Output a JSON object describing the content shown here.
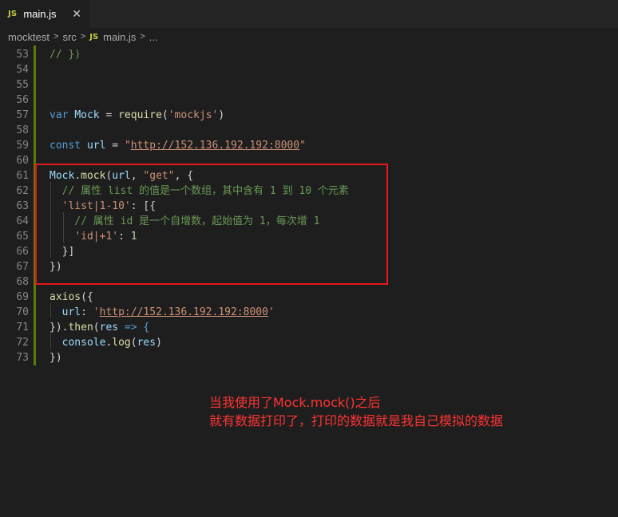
{
  "tab": {
    "icon": "JS",
    "label": "main.js",
    "close": "✕"
  },
  "breadcrumb": [
    "mocktest",
    "src",
    "main.js",
    "..."
  ],
  "breadcrumb_icon": "JS",
  "lines": [
    {
      "n": "53",
      "tokens": [
        {
          "t": "// })",
          "c": "cmt"
        }
      ]
    },
    {
      "n": "54",
      "tokens": []
    },
    {
      "n": "55",
      "tokens": []
    },
    {
      "n": "56",
      "tokens": []
    },
    {
      "n": "57",
      "tokens": [
        {
          "t": "var ",
          "c": "kw"
        },
        {
          "t": "Mock",
          "c": "var"
        },
        {
          "t": " = ",
          "c": ""
        },
        {
          "t": "require",
          "c": "fn"
        },
        {
          "t": "(",
          "c": ""
        },
        {
          "t": "'mockjs'",
          "c": "str"
        },
        {
          "t": ")",
          "c": ""
        }
      ]
    },
    {
      "n": "58",
      "tokens": []
    },
    {
      "n": "59",
      "tokens": [
        {
          "t": "const ",
          "c": "kw"
        },
        {
          "t": "url",
          "c": "var"
        },
        {
          "t": " = ",
          "c": ""
        },
        {
          "t": "\"",
          "c": "str"
        },
        {
          "t": "http://152.136.192.192:8000",
          "c": "str url"
        },
        {
          "t": "\"",
          "c": "str"
        }
      ]
    },
    {
      "n": "60",
      "tokens": []
    },
    {
      "n": "61",
      "tokens": [
        {
          "t": "Mock",
          "c": "var"
        },
        {
          "t": ".",
          "c": ""
        },
        {
          "t": "mock",
          "c": "fn"
        },
        {
          "t": "(",
          "c": ""
        },
        {
          "t": "url",
          "c": "var"
        },
        {
          "t": ", ",
          "c": ""
        },
        {
          "t": "\"get\"",
          "c": "str"
        },
        {
          "t": ", {",
          "c": ""
        }
      ]
    },
    {
      "n": "62",
      "tokens": [
        {
          "t": "  // 属性 list 的值是一个数组，其中含有 1 到 10 个元素",
          "c": "cmt"
        }
      ]
    },
    {
      "n": "63",
      "tokens": [
        {
          "t": "  ",
          "c": ""
        },
        {
          "t": "'list|1-10'",
          "c": "str"
        },
        {
          "t": ": [{",
          "c": ""
        }
      ]
    },
    {
      "n": "64",
      "tokens": [
        {
          "t": "    // 属性 id 是一个自增数，起始值为 1，每次增 1",
          "c": "cmt"
        }
      ]
    },
    {
      "n": "65",
      "tokens": [
        {
          "t": "    ",
          "c": ""
        },
        {
          "t": "'id|+1'",
          "c": "str"
        },
        {
          "t": ": ",
          "c": ""
        },
        {
          "t": "1",
          "c": "num"
        }
      ]
    },
    {
      "n": "66",
      "tokens": [
        {
          "t": "  }]",
          "c": ""
        }
      ]
    },
    {
      "n": "67",
      "tokens": [
        {
          "t": "})",
          "c": ""
        }
      ]
    },
    {
      "n": "68",
      "tokens": []
    },
    {
      "n": "69",
      "tokens": [
        {
          "t": "axios",
          "c": "fn"
        },
        {
          "t": "({",
          "c": ""
        }
      ]
    },
    {
      "n": "70",
      "tokens": [
        {
          "t": "  ",
          "c": ""
        },
        {
          "t": "url",
          "c": "var"
        },
        {
          "t": ": ",
          "c": ""
        },
        {
          "t": "'",
          "c": "str"
        },
        {
          "t": "http://152.136.192.192:8000",
          "c": "str url"
        },
        {
          "t": "'",
          "c": "str"
        }
      ]
    },
    {
      "n": "71",
      "tokens": [
        {
          "t": "}).",
          "c": ""
        },
        {
          "t": "then",
          "c": "fn"
        },
        {
          "t": "(",
          "c": ""
        },
        {
          "t": "res",
          "c": "var"
        },
        {
          "t": " => {",
          "c": "kw"
        }
      ]
    },
    {
      "n": "72",
      "tokens": [
        {
          "t": "  ",
          "c": ""
        },
        {
          "t": "console",
          "c": "var"
        },
        {
          "t": ".",
          "c": ""
        },
        {
          "t": "log",
          "c": "fn"
        },
        {
          "t": "(",
          "c": ""
        },
        {
          "t": "res",
          "c": "var"
        },
        {
          "t": ")",
          "c": ""
        }
      ]
    },
    {
      "n": "73",
      "tokens": [
        {
          "t": "})",
          "c": ""
        }
      ]
    }
  ],
  "annotation": {
    "line1": "当我使用了Mock.mock()之后",
    "line2": "就有数据打印了，打印的数据就是我自己模拟的数据"
  },
  "colors": {
    "background": "#1e1e1e",
    "keyword": "#569cd6",
    "variable": "#9cdcfe",
    "function": "#dcdcaa",
    "string": "#ce9178",
    "comment": "#6a9955",
    "number": "#b5cea8",
    "annotation": "#ff3333",
    "box": "#e51919"
  }
}
